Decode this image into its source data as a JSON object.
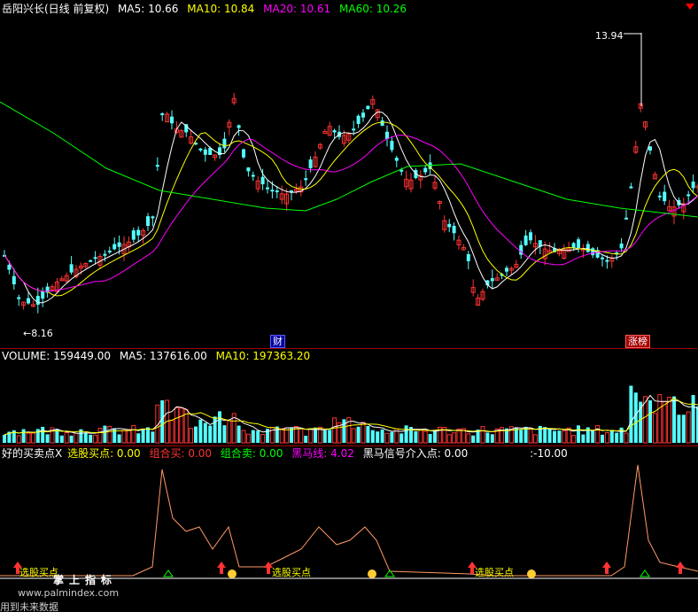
{
  "main_header": {
    "title": "岳阳兴长(日线 前复权)",
    "ma5": "MA5: 10.66",
    "ma10": "MA10: 10.84",
    "ma20": "MA20: 10.61",
    "ma60": "MA60: 10.26"
  },
  "annotations": {
    "high": "13.94",
    "low": "←8.16",
    "event1": "财",
    "event2": "涨榜"
  },
  "volume_header": {
    "label": "VOLUME: 159449.00",
    "ma5": "MA5: 137616.00",
    "ma10": "MA10: 197363.20"
  },
  "indicator_header": {
    "name": "好的买卖点X",
    "pick": "选股买点: 0.00",
    "combo": "组合买: 0.00",
    "combo2": "组合卖: 0.00",
    "horse": "黑马线: 4.02",
    "horse_sig": "黑马信号介入点: 0.00",
    "extra": ":-10.00"
  },
  "signals": [
    "选股买点",
    "选股买点",
    "选股买点"
  ],
  "watermark": {
    "line1": "掌上指标",
    "line2": "www.palmindex.com",
    "line3": "用到未来数据"
  },
  "colors": {
    "up": "#ff3333",
    "down": "#54ffff",
    "ma5": "#ffffff",
    "ma10": "#ffff00",
    "ma20": "#ff00ff",
    "ma60": "#00ff00"
  },
  "chart_data": {
    "type": "candlestick",
    "price_high": 13.94,
    "price_low": 8.16,
    "ma_last": {
      "MA5": 10.66,
      "MA10": 10.84,
      "MA20": 10.61,
      "MA60": 10.26
    },
    "volume_last": 159449.0,
    "volume_ma_last": {
      "MA5": 137616.0,
      "MA10": 197363.2
    }
  }
}
